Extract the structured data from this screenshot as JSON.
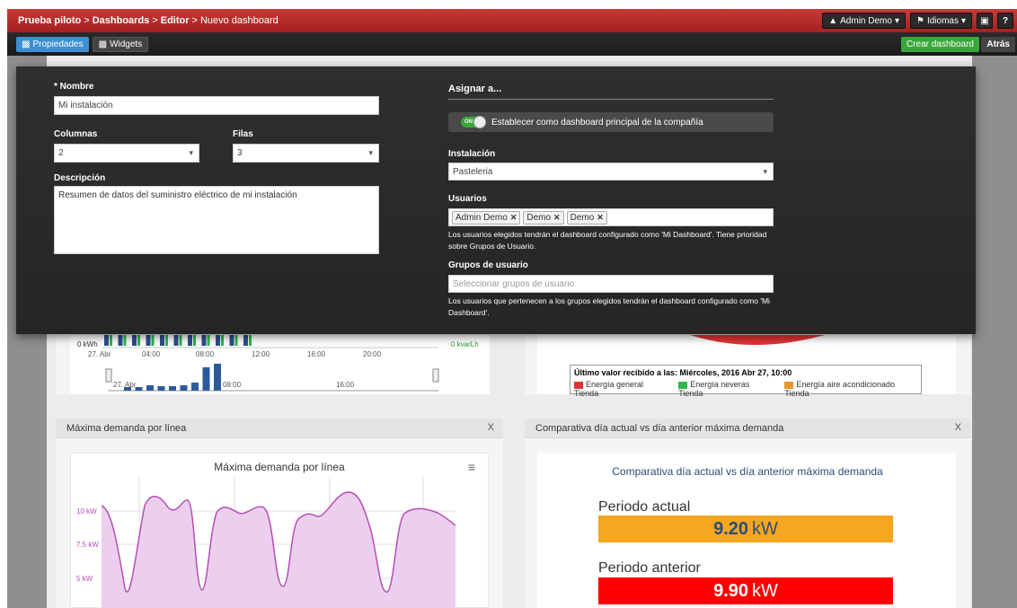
{
  "breadcrumb": {
    "items": [
      "Prueba piloto",
      "Dashboards",
      "Editor"
    ],
    "current": "Nuevo dashboard",
    "separator": ">"
  },
  "topbar": {
    "user_label": "Admin Demo",
    "languages_label": "Idiomas",
    "help_label": "?"
  },
  "toolbar": {
    "tab_properties": "Propiedades",
    "tab_widgets": "Widgets",
    "create_label": "Crear dashboard",
    "back_label": "Atrás"
  },
  "form": {
    "name_label": "* Nombre",
    "name_value": "Mi instalación",
    "columns_label": "Columnas",
    "columns_value": "2",
    "rows_label": "Filas",
    "rows_value": "3",
    "description_label": "Descripción",
    "description_value": "Resumen de datos del suministro eléctrico de mi instalación",
    "assign_title": "Asignar a...",
    "toggle_state": "ON",
    "toggle_text": "Establecer como dashboard principal de la compañía",
    "installation_label": "Instalación",
    "installation_value": "Pasteleria",
    "users_label": "Usuarios",
    "users": [
      "Admin Demo",
      "Demo",
      "Demo"
    ],
    "users_help": "Los usuarios elegidos tendrán el dashboard configurado como 'Mi Dashboard'. Tiene prioridad sobre Grupos de Usuario.",
    "groups_label": "Grupos de usuario",
    "groups_placeholder": "Seleccionar grupos de usuario",
    "groups_help": "Los usuarios que pertenecen a los grupos elegidos tendrán el dashboard configurado como 'Mi Dashboard'."
  },
  "bg_top_left": {
    "y_left_label": "0 kWh",
    "y_right_label": "0 kvarLh",
    "x_ticks": [
      "27. Abr",
      "04:00",
      "08:00",
      "12:00",
      "16:00",
      "20:00"
    ],
    "nav_ticks": [
      "27. Abr",
      "08:00",
      "16:00"
    ]
  },
  "bg_top_right": {
    "last_value": "Último valor recibido a las: Miércoles, 2016 Abr 27, 10:00",
    "legend": [
      {
        "label": "Energía general Tienda",
        "color": "#e03333"
      },
      {
        "label": "Energía neveras Tienda",
        "color": "#2db84d"
      },
      {
        "label": "Energía aire acondicionado Tienda",
        "color": "#e8962e"
      }
    ]
  },
  "widget_demand": {
    "header": "Máxima demanda por línea",
    "close": "X",
    "chart_title": "Máxima demanda por línea",
    "y_ticks": [
      "10 kW",
      "7.5 kW",
      "5 kW"
    ]
  },
  "widget_compare": {
    "header": "Comparativa día actual vs día anterior máxima demanda",
    "close": "X",
    "title": "Comparativa día actual vs día anterior máxima demanda",
    "current_label": "Periodo actual",
    "current_value": "9.20",
    "current_unit": "kW",
    "current_color": "#f5a623",
    "previous_label": "Periodo anterior",
    "previous_value": "9.90",
    "previous_unit": "kW",
    "previous_color": "#ff0000"
  },
  "chart_data": {
    "type": "area",
    "title": "Máxima demanda por línea",
    "y_ticks": [
      "10 kW",
      "7.5 kW",
      "5 kW"
    ],
    "color": "#b54fb5",
    "fill": "#eccfee"
  }
}
